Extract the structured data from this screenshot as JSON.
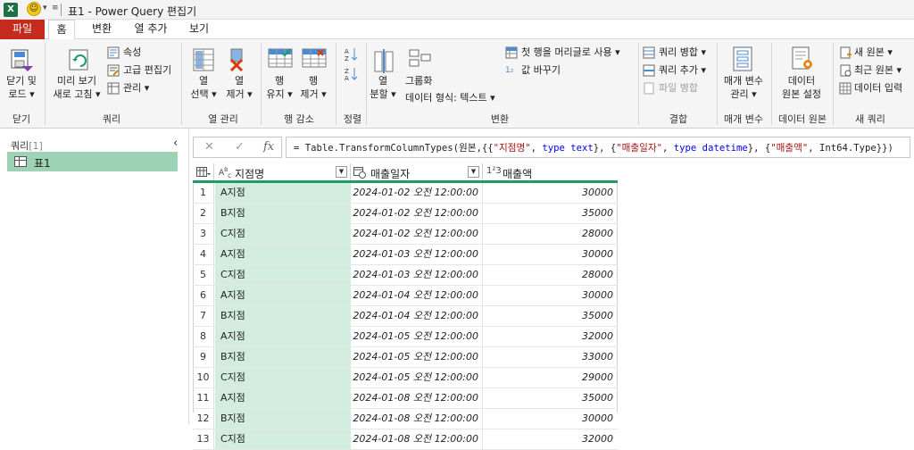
{
  "window": {
    "title": "표1 - Power Query 편집기",
    "app_icon": "X"
  },
  "tabs": [
    {
      "label": "파일"
    },
    {
      "label": "홈"
    },
    {
      "label": "변환"
    },
    {
      "label": "열 추가"
    },
    {
      "label": "보기"
    }
  ],
  "ribbon": {
    "close_apply": {
      "line1": "닫기 및",
      "line2": "로드 ▾"
    },
    "refresh_preview": {
      "line1": "미리 보기",
      "line2": "새로 고침 ▾"
    },
    "properties": "속성",
    "advanced_editor": "고급 편집기",
    "manage": "관리 ▾",
    "choose_columns": {
      "line1": "열",
      "line2": "선택 ▾"
    },
    "remove_columns": {
      "line1": "열",
      "line2": "제거 ▾"
    },
    "keep_rows": {
      "line1": "행",
      "line2": "유지 ▾"
    },
    "remove_rows": {
      "line1": "행",
      "line2": "제거 ▾"
    },
    "split_column": {
      "line1": "열",
      "line2": "분할 ▾"
    },
    "group_by": "그룹화",
    "data_type": "데이터 형식: 텍스트 ▾",
    "use_first_row": "첫 행을 머리글로 사용 ▾",
    "replace_values": "값 바꾸기",
    "merge_queries": "쿼리 병합 ▾",
    "append_queries": "쿼리 추가 ▾",
    "combine_files": "파일 병합",
    "manage_params": {
      "line1": "매개 변수",
      "line2": "관리 ▾"
    },
    "data_source_settings": {
      "line1": "데이터",
      "line2": "원본 설정"
    },
    "new_source": "새 원본 ▾",
    "recent_sources": "최근 원본 ▾",
    "enter_data": "데이터 입력",
    "groups": {
      "close": "닫기",
      "query": "쿼리",
      "manage_columns": "열 관리",
      "reduce_rows": "행 감소",
      "sort": "정렬",
      "transform": "변환",
      "combine": "결합",
      "parameters": "매개 변수",
      "data_sources": "데이터 원본",
      "new_query": "새 쿼리"
    }
  },
  "queries_pane": {
    "header": "쿼리",
    "count": "[1]",
    "collapse": "‹",
    "items": [
      {
        "label": "표1"
      }
    ]
  },
  "formula_bar": {
    "cancel": "✕",
    "confirm": "✓",
    "fx": "fx",
    "formula_prefix": "= Table.TransformColumnTypes(원본,{{",
    "formula_parts": [
      "\"지점명\"",
      ", ",
      "type text",
      "}, {",
      "\"매출일자\"",
      ", ",
      "type datetime",
      "}, {",
      "\"매출액\"",
      ", Int64.Type}})"
    ]
  },
  "grid": {
    "columns": [
      {
        "name": "지점명",
        "type_icon": "ABC"
      },
      {
        "name": "매출일자",
        "type_icon": "calendar-clock"
      },
      {
        "name": "매출액",
        "type_icon": "123"
      }
    ],
    "rows": [
      [
        "1",
        "A지점",
        "2024-01-02 오전 12:00:00",
        "30000"
      ],
      [
        "2",
        "B지점",
        "2024-01-02 오전 12:00:00",
        "35000"
      ],
      [
        "3",
        "C지점",
        "2024-01-02 오전 12:00:00",
        "28000"
      ],
      [
        "4",
        "A지점",
        "2024-01-03 오전 12:00:00",
        "30000"
      ],
      [
        "5",
        "C지점",
        "2024-01-03 오전 12:00:00",
        "28000"
      ],
      [
        "6",
        "A지점",
        "2024-01-04 오전 12:00:00",
        "30000"
      ],
      [
        "7",
        "B지점",
        "2024-01-04 오전 12:00:00",
        "35000"
      ],
      [
        "8",
        "A지점",
        "2024-01-05 오전 12:00:00",
        "32000"
      ],
      [
        "9",
        "B지점",
        "2024-01-05 오전 12:00:00",
        "33000"
      ],
      [
        "10",
        "C지점",
        "2024-01-05 오전 12:00:00",
        "29000"
      ],
      [
        "11",
        "A지점",
        "2024-01-08 오전 12:00:00",
        "35000"
      ],
      [
        "12",
        "B지점",
        "2024-01-08 오전 12:00:00",
        "30000"
      ],
      [
        "13",
        "C지점",
        "2024-01-08 오전 12:00:00",
        "32000"
      ]
    ]
  },
  "colors": {
    "accent": "#1e9c64",
    "file_tab": "#c42b1c",
    "selected_col": "#d2ede0"
  }
}
